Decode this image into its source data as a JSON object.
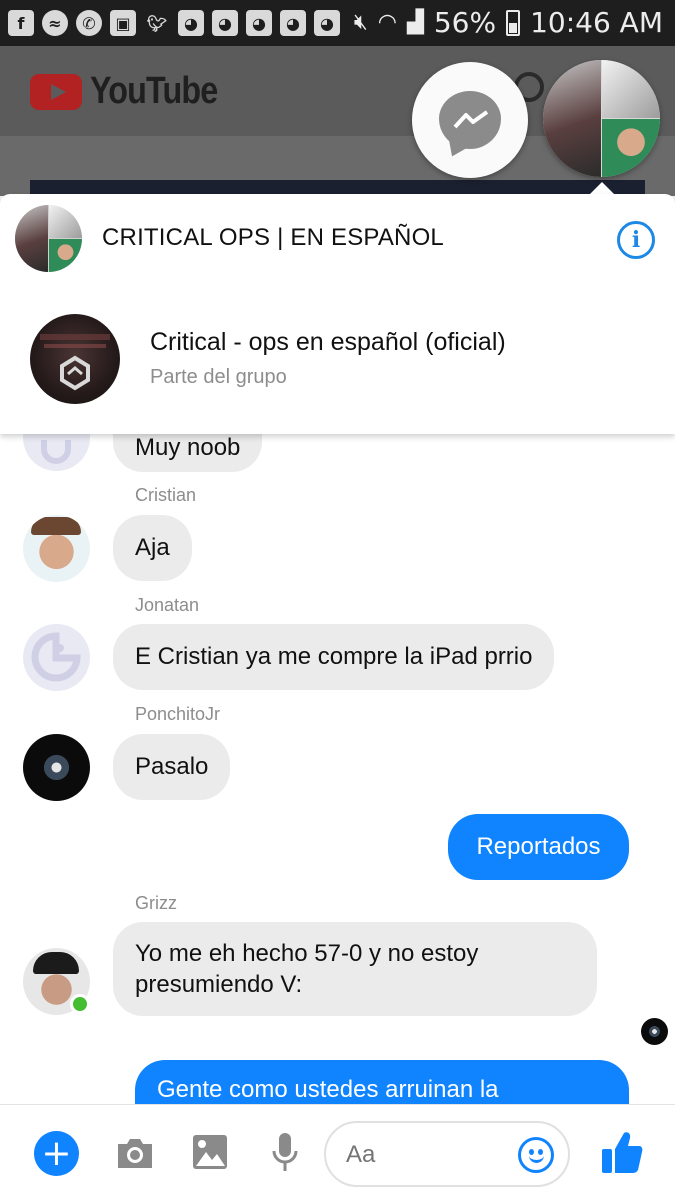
{
  "status_bar": {
    "battery_percent": "56%",
    "time": "10:46 AM",
    "notification_icons": [
      "facebook-icon",
      "messenger-icon",
      "whatsapp-icon",
      "gallery-icon",
      "twitter-icon",
      "discord-icon",
      "discord-icon",
      "discord-icon",
      "discord-icon",
      "discord-icon"
    ]
  },
  "background_app": {
    "name": "YouTube"
  },
  "conversation": {
    "title": "CRITICAL OPS | EN ESPAÑOL",
    "group_name": "Critical - ops en español (oficial)",
    "group_subtitle": "Parte del grupo"
  },
  "messages": [
    {
      "sender": "",
      "text": "Muy noob",
      "direction": "incoming"
    },
    {
      "sender": "Cristian",
      "text": "Aja",
      "direction": "incoming"
    },
    {
      "sender": "Jonatan",
      "text": "E Cristian ya me compre la iPad prrio",
      "direction": "incoming"
    },
    {
      "sender": "PonchitoJr",
      "text": "Pasalo",
      "direction": "incoming"
    },
    {
      "sender": "",
      "text": "Reportados",
      "direction": "outgoing"
    },
    {
      "sender": "Grizz",
      "text": "Yo me eh hecho 57-0 y no estoy presumiendo V:",
      "direction": "incoming"
    },
    {
      "sender": "",
      "text": "Gente como ustedes arruinan la",
      "direction": "outgoing"
    }
  ],
  "composer": {
    "placeholder": "Aa"
  },
  "colors": {
    "accent": "#0f84fe",
    "incoming_bubble": "#ebebeb"
  }
}
